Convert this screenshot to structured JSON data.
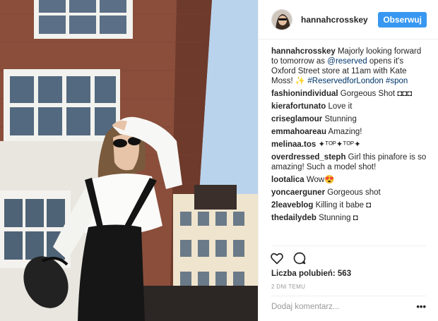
{
  "post": {
    "username": "hannahcrosskey",
    "follow_label": "Obserwuj",
    "caption": {
      "author": "hannahcrosskey",
      "text_1": "Majorly looking forward to tomorrow as",
      "mention": "@reserved",
      "text_2": "opens it's Oxford Street store at 11am with Kate Moss! ✨",
      "hashtags": "#ReservedforLondon #spon"
    },
    "comments": [
      {
        "author": "fashionindividual",
        "text": "Gorgeous Shot ◘◘◘"
      },
      {
        "author": "kierafortunato",
        "text": "Love it"
      },
      {
        "author": "criseglamour",
        "text": "Stunning"
      },
      {
        "author": "emmahoareau",
        "text": "Amazing!"
      },
      {
        "author": "melinaa.tos",
        "text": "✦ᵀᴼᴾ✦ᵀᴼᴾ✦"
      },
      {
        "author": "overdressed_steph",
        "text": "Girl this pinafore is so amazing! Such a model shot!"
      },
      {
        "author": "lootalica",
        "text": "Wow😍"
      },
      {
        "author": "yoncaerguner",
        "text": "Gorgeous shot"
      },
      {
        "author": "2leaveblog",
        "text": "Killing it babe ◘"
      },
      {
        "author": "thedailydeb",
        "text": "Stunning ◘"
      }
    ],
    "likes_label": "Liczba polubień: 563",
    "date": "2 DNI TEMU",
    "add_comment_placeholder": "Dodaj komentarz...",
    "more_options": "•••",
    "icons": {
      "like": "heart-outline-icon",
      "comment": "speech-bubble-icon",
      "more": "ellipsis-icon"
    },
    "colors": {
      "follow_button": "#3897f0",
      "hashtag": "#003569",
      "secondary_text": "#999999"
    }
  }
}
